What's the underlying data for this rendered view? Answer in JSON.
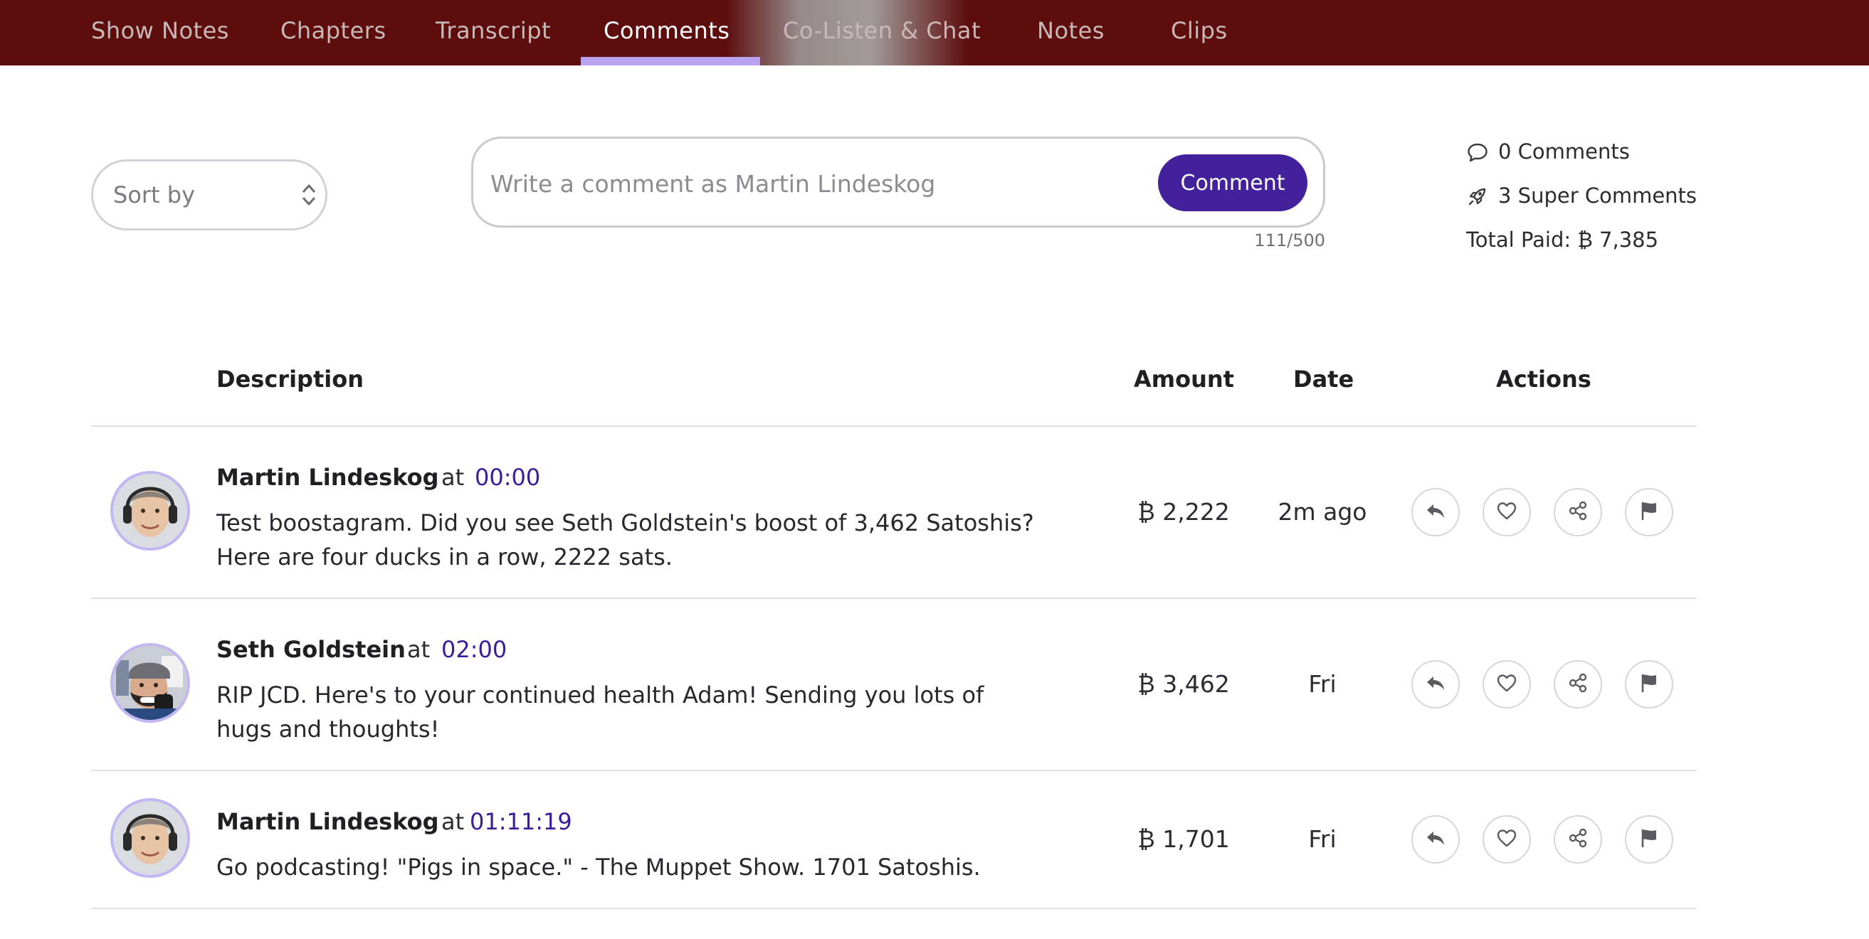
{
  "tabs": [
    {
      "label": "Show Notes"
    },
    {
      "label": "Chapters"
    },
    {
      "label": "Transcript"
    },
    {
      "label": "Comments",
      "active": true
    },
    {
      "label": "Co-Listen & Chat"
    },
    {
      "label": "Notes"
    },
    {
      "label": "Clips"
    }
  ],
  "sort": {
    "label": "Sort by"
  },
  "composer": {
    "placeholder": "Write a comment as Martin Lindeskog",
    "button_label": "Comment",
    "char_count": "111/500"
  },
  "stats": {
    "comments": "0 Comments",
    "super_comments": "3 Super Comments",
    "total_paid": "Total Paid:  ₿ 7,385"
  },
  "table": {
    "headers": {
      "description": "Description",
      "amount": "Amount",
      "date": "Date",
      "actions": "Actions"
    },
    "at_label": "at",
    "rows": [
      {
        "name": "Martin Lindeskog",
        "time": "00:00",
        "text_line1": "Test boostagram. Did you see Seth Goldstein's boost of 3,462 Satoshis?",
        "text_line2": "Here are four ducks in a row, 2222 sats.",
        "amount": "₿ 2,222",
        "date": "2m ago"
      },
      {
        "name": "Seth Goldstein",
        "time": "02:00",
        "text_line1": "RIP JCD. Here's to your continued health Adam! Sending you lots of",
        "text_line2": "hugs and thoughts!",
        "amount": "₿ 3,462",
        "date": "Fri"
      },
      {
        "name": "Martin Lindeskog",
        "time": "01:11:19",
        "text_line1": "Go podcasting! \"Pigs in space.\" - The Muppet Show. 1701 Satoshis.",
        "text_line2": "",
        "amount": "₿ 1,701",
        "date": "Fri"
      }
    ]
  },
  "colors": {
    "nav_bg": "#5e0d0d",
    "accent": "#43209c",
    "tab_underline": "#b9a2f0",
    "avatar_ring": "#c4b6f3"
  },
  "icons": [
    "reply-icon",
    "heart-icon",
    "share-icon",
    "flag-icon",
    "comment-bubble-icon",
    "rocket-icon",
    "sort-arrows-icon"
  ]
}
